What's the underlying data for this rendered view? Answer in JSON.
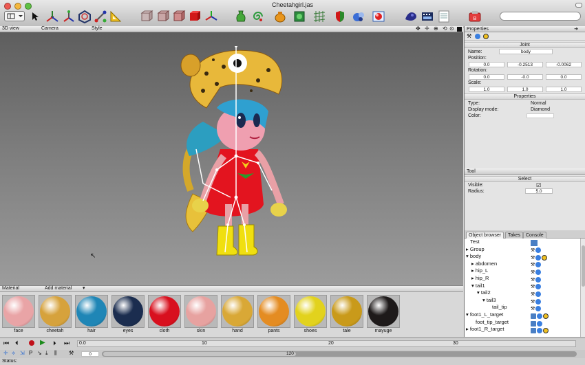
{
  "window": {
    "title": "Cheetahgirl.jas"
  },
  "toolbar": {
    "search_placeholder": "",
    "icons": [
      "layout-icon",
      "select-arrow-icon",
      "move-icon",
      "bones-icon",
      "rotate-icon",
      "scale-icon",
      "ruler-icon",
      "cube-wire-icon",
      "cube-front-icon",
      "cube-side-icon",
      "cube-red-icon",
      "axis-icon",
      "vase-icon",
      "spiral-icon",
      "pot-icon",
      "box-icon",
      "grid-icon",
      "shield-icon",
      "paint-icon",
      "render-icon",
      "material-icon",
      "film-icon",
      "notes-icon",
      "camera-icon"
    ]
  },
  "viewport": {
    "label": "3D view",
    "camera": "Camera",
    "style": "Style"
  },
  "properties": {
    "title": "Properties",
    "joint_header": "Joint",
    "name_label": "Name:",
    "name_value": "body",
    "position_label": "Position:",
    "position": [
      "0.0",
      "-0.2513",
      "-0.0062"
    ],
    "rotation_label": "Rotation:",
    "rotation": [
      "0.0",
      "-0.0",
      "0.0"
    ],
    "scale_label": "Scale:",
    "scale": [
      "1.0",
      "1.0",
      "1.0"
    ],
    "props_header": "Properties",
    "type_label": "Type:",
    "type_value": "Normal",
    "display_label": "Display mode:",
    "display_value": "Diamond",
    "color_label": "Color:"
  },
  "tool": {
    "title": "Tool",
    "select_header": "Select",
    "visible_label": "Visible:",
    "visible_checked": true,
    "radius_label": "Radius:",
    "radius_value": "5.0"
  },
  "browser": {
    "tabs": [
      "Object browser",
      "Takes",
      "Console"
    ],
    "active_tab": "Object browser",
    "rows": [
      {
        "label": "Test"
      },
      {
        "label": "Group"
      },
      {
        "label": "body"
      },
      {
        "label": "abdomen"
      },
      {
        "label": "hip_L"
      },
      {
        "label": "hip_R"
      },
      {
        "label": "tail1"
      },
      {
        "label": "tail2"
      },
      {
        "label": "tail3"
      },
      {
        "label": "tail_tip"
      },
      {
        "label": "foot1_L_target"
      },
      {
        "label": "foot_tip_target"
      },
      {
        "label": "foot1_R_target"
      }
    ]
  },
  "material": {
    "label": "Material",
    "add_label": "Add material",
    "items": [
      {
        "name": "face",
        "color": "#e9a4a6"
      },
      {
        "name": "cheetah",
        "color": "#d6a23c"
      },
      {
        "name": "hair",
        "color": "#1f86b6"
      },
      {
        "name": "eyes",
        "color": "#1b2d4f"
      },
      {
        "name": "cloth",
        "color": "#d8101e"
      },
      {
        "name": "skin",
        "color": "#e7a2a0"
      },
      {
        "name": "hand",
        "color": "#d9a836"
      },
      {
        "name": "pants",
        "color": "#e48c22"
      },
      {
        "name": "shoes",
        "color": "#e2d21d"
      },
      {
        "name": "tale",
        "color": "#c99a1a"
      },
      {
        "name": "mayuge",
        "color": "#1e1a1a"
      }
    ]
  },
  "timeline": {
    "ticks": [
      "0.0",
      "10",
      "20",
      "30"
    ],
    "current_frame": "0",
    "end_frame": "120",
    "status": "Status:"
  }
}
